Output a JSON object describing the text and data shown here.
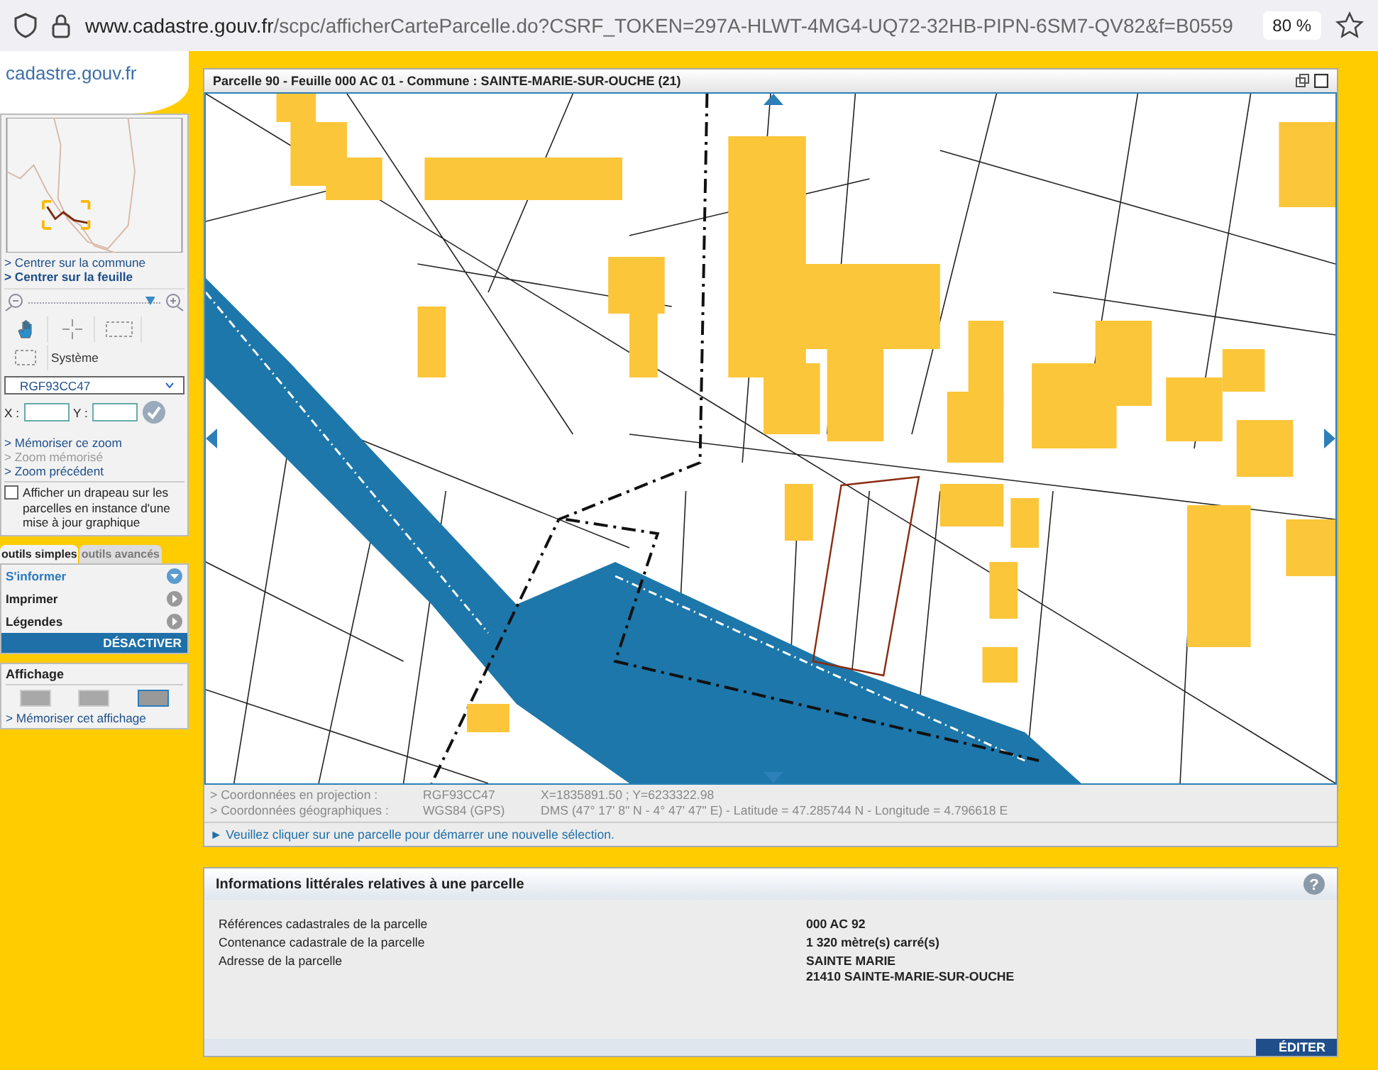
{
  "browser": {
    "url_host": "www.cadastre.gouv.fr",
    "url_path": "/scpc/afficherCarteParcelle.do?CSRF_TOKEN=297A-HLWT-4MG4-UQ72-32HB-PIPN-6SM7-QV82&f=B0559",
    "zoom": "80 %"
  },
  "logo": "cadastre.gouv.fr",
  "sidebar": {
    "links": [
      {
        "label": "> Centrer sur la commune",
        "bold": false
      },
      {
        "label": "> Centrer sur la feuille",
        "bold": true
      }
    ],
    "zoom": {
      "level": 0.93
    },
    "tools": [
      {
        "kind": "pan",
        "selected": true
      },
      {
        "kind": "center",
        "selected": false
      },
      {
        "kind": "zoombox",
        "selected": false
      },
      {
        "kind": "extent",
        "selected": false
      }
    ],
    "system_label": "Système",
    "projection": "RGF93CC47",
    "x_label": "X :",
    "y_label": "Y :",
    "memo_links": [
      {
        "label": "> Mémoriser ce zoom",
        "disabled": false
      },
      {
        "label": "> Zoom mémorisé",
        "disabled": true
      },
      {
        "label": "> Zoom précédent",
        "disabled": false
      }
    ],
    "flag": {
      "label": "Afficher un drapeau sur les parcelles en instance d'une mise à jour graphique",
      "checked": false
    },
    "tabs": [
      {
        "label": "outils simples",
        "selected": true
      },
      {
        "label": "outils avancés",
        "selected": false
      }
    ],
    "items": [
      {
        "label": "S'informer",
        "selected": true
      },
      {
        "label": "Imprimer",
        "selected": false
      },
      {
        "label": "Légendes",
        "selected": false
      }
    ],
    "deactivate": "DÉSACTIVER",
    "display": {
      "title": "Affichage",
      "modes": [
        {
          "selected": false
        },
        {
          "selected": false
        },
        {
          "selected": true
        }
      ],
      "link": "> Mémoriser cet affichage"
    }
  },
  "map": {
    "title": "Parcelle 90 - Feuille 000 AC 01 - Commune : SAINTE-MARIE-SUR-OUCHE (21)",
    "coords": [
      {
        "label": "> Coordonnées en projection :",
        "system": "RGF93CC47",
        "value": "X=1835891.50 ; Y=6233322.98"
      },
      {
        "label": "> Coordonnées géographiques :",
        "system": "WGS84 (GPS)",
        "value": "DMS (47° 17' 8\" N - 4° 47' 47\" E) - Latitude = 47.285744 N - Longitude = 4.796618 E"
      }
    ],
    "message": "► Veuillez cliquer sur une parcelle pour démarrer une nouvelle sélection."
  },
  "info": {
    "title": "Informations littérales relatives à une parcelle",
    "rows": [
      {
        "label": "Références cadastrales de la parcelle",
        "value": [
          "000 AC 92"
        ]
      },
      {
        "label": "Contenance cadastrale de la parcelle",
        "value": [
          "1 320 mètre(s) carré(s)"
        ]
      },
      {
        "label": "Adresse de la parcelle",
        "value": [
          "SAINTE MARIE",
          "21410 SAINTE-MARIE-SUR-OUCHE"
        ]
      }
    ],
    "edit": "ÉDITER",
    "help": "?"
  }
}
